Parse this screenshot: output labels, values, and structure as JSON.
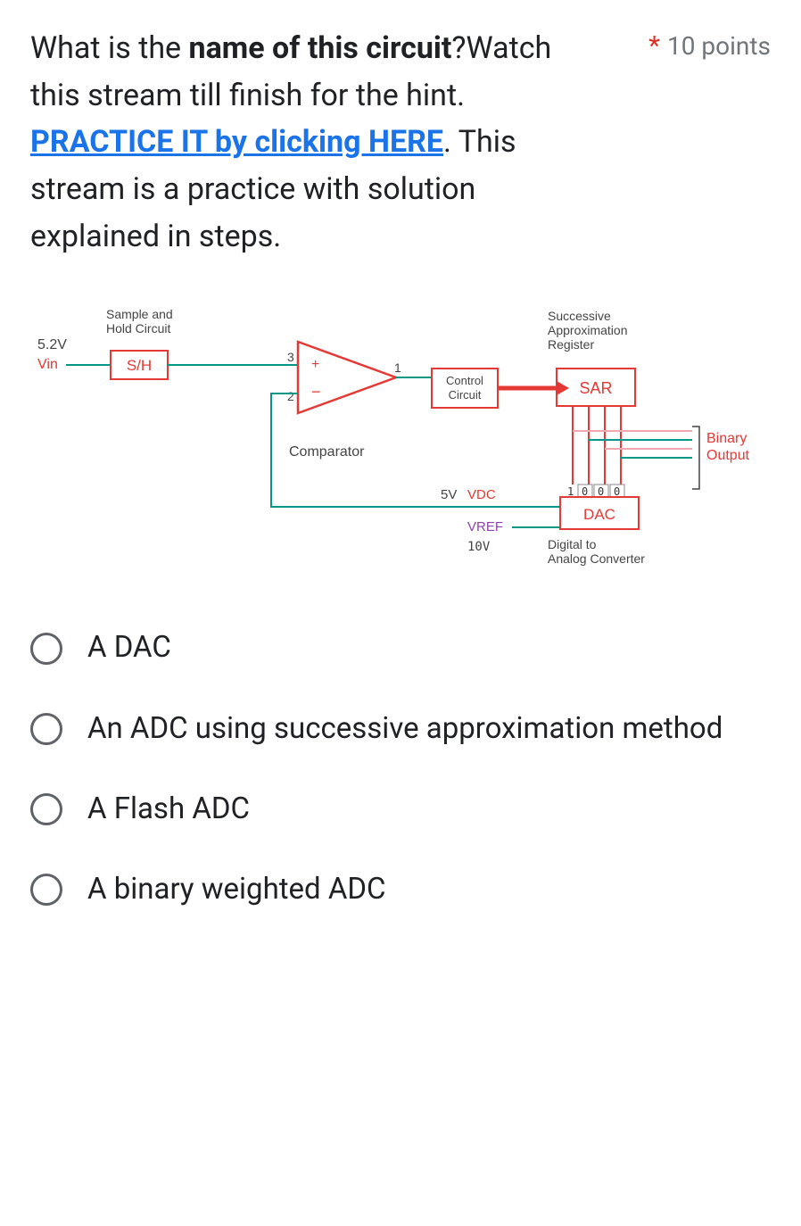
{
  "question": {
    "text_part1": "What is the ",
    "bold1": "name of this circuit",
    "text_part2": "?Watch this stream till finish for the hint.",
    "link_text": " PRACTICE IT by clicking HERE",
    "text_part3": ". This stream is a practice with solution explained in steps.",
    "required_mark": "*",
    "points": "10 points"
  },
  "diagram": {
    "vin_voltage": "5.2V",
    "vin_label": "Vin",
    "sh_label": "S/H",
    "sh_title": "Sample and\nHold Circuit",
    "comp_plus": "+",
    "comp_minus": "−",
    "comp_in1": "3",
    "comp_in2": "2",
    "comp_out": "1",
    "comp_label": "Comparator",
    "ctrl_label": "Control\nCircuit",
    "sar_label": "SAR",
    "sar_title": "Successive\nApproximation\nRegister",
    "dac_label": "DAC",
    "dac_title": "Digital to\nAnalog Converter",
    "vdc_label": "5V",
    "vdc_text": "VDC",
    "vref_label": "VREF",
    "vref_value": "10V",
    "binary_out": "Binary\nOutput",
    "bits": [
      "1",
      "0",
      "0",
      "0"
    ]
  },
  "options": [
    {
      "label": "A DAC"
    },
    {
      "label": "An ADC using successive approximation method"
    },
    {
      "label": "A Flash ADC"
    },
    {
      "label": "A binary weighted ADC"
    }
  ]
}
